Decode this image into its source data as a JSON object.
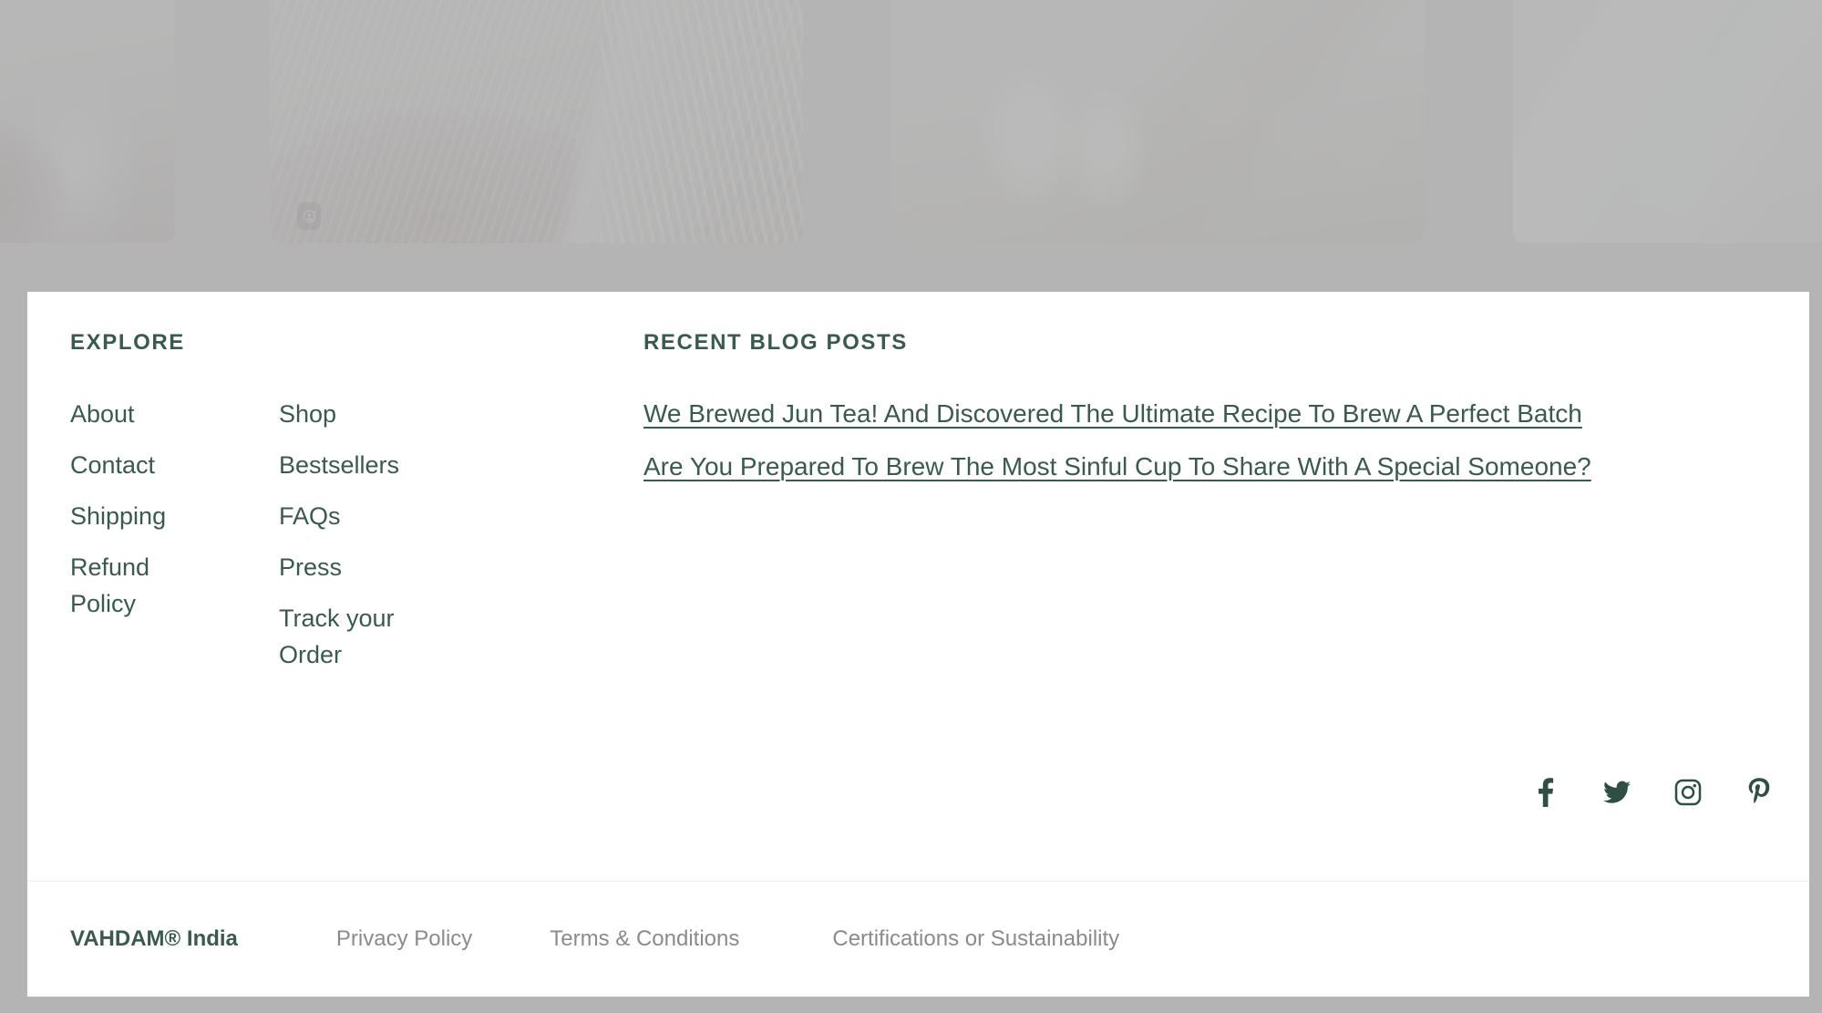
{
  "carousel": {
    "cards": [
      {
        "name": "tea-photo-1",
        "alt": "Person in red holding glassware"
      },
      {
        "name": "tea-photo-2",
        "alt": "Red plaid cloth on wooden table with woven stack"
      },
      {
        "name": "tea-photo-3",
        "alt": "White cups on grass beside a wooden tray"
      },
      {
        "name": "tea-photo-4",
        "alt": "Pale blue folded cloth"
      }
    ],
    "badge_icon": "user-circle-icon"
  },
  "footer": {
    "explore": {
      "heading": "EXPLORE",
      "columns": [
        [
          "About",
          "Contact",
          "Shipping",
          "Refund Policy"
        ],
        [
          "Shop",
          "Bestsellers",
          "FAQs",
          "Press",
          "Track your Order"
        ]
      ]
    },
    "blog": {
      "heading": "RECENT BLOG POSTS",
      "posts": [
        "We Brewed Jun Tea! And Discovered The Ultimate Recipe To Brew A Perfect Batch",
        "Are You Prepared To Brew The Most Sinful Cup To Share With A Special Someone?"
      ]
    },
    "social": [
      {
        "name": "facebook-icon",
        "label": "Facebook"
      },
      {
        "name": "twitter-icon",
        "label": "Twitter"
      },
      {
        "name": "instagram-icon",
        "label": "Instagram"
      },
      {
        "name": "pinterest-icon",
        "label": "Pinterest"
      }
    ],
    "legal": [
      "VAHDAM® India",
      "Privacy Policy",
      "Terms & Conditions",
      "Certifications or Sustainability"
    ]
  },
  "colors": {
    "brand_green": "#3b5950",
    "icon_green": "#2f4f45",
    "legal_gray": "#8b8b8b",
    "page_background": "#b4b4b4",
    "panel_background": "#ffffff",
    "divider": "#ececec"
  }
}
